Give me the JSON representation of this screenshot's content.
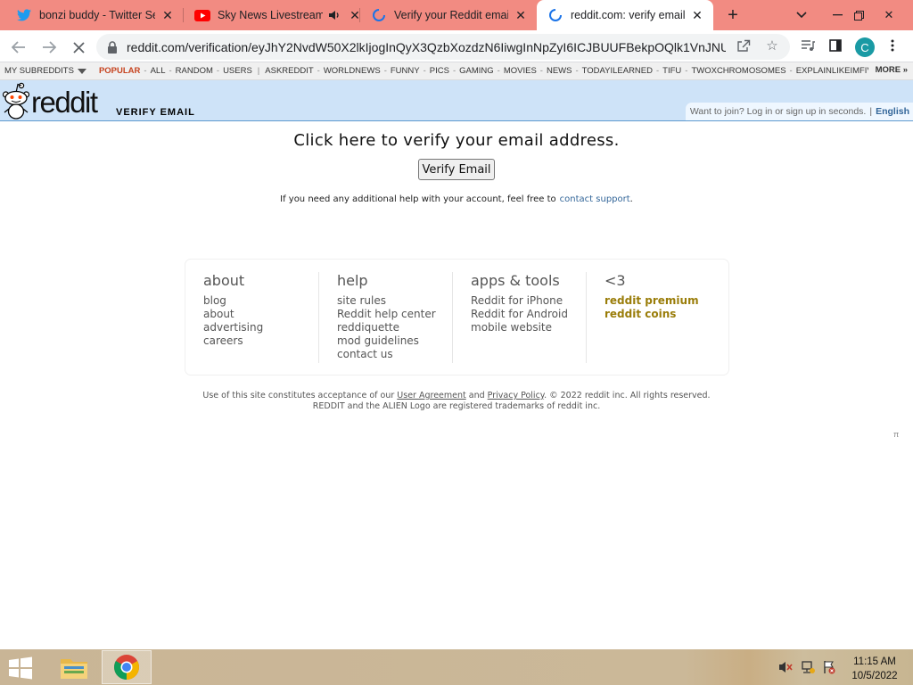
{
  "browser": {
    "tabs": [
      {
        "title": "bonzi buddy - Twitter Se",
        "favicon": "twitter-icon"
      },
      {
        "title": "Sky News Livestream",
        "favicon": "youtube-icon",
        "audio": true
      },
      {
        "title": "Verify your Reddit email",
        "favicon": "loading-spinner-icon"
      },
      {
        "title": "reddit.com: verify email",
        "favicon": "loading-spinner-icon",
        "active": true
      }
    ],
    "url": "reddit.com/verification/eyJhY2NvdW50X2lkIjogInQyX3QzbXozdzN6IiwgInNpZyI6ICJBUUFBekpOQlk1VnJNU...",
    "profile_initial": "C"
  },
  "subreddit_bar": {
    "my_subreddits": "MY SUBREDDITS",
    "popular": "POPULAR",
    "group1": [
      "ALL",
      "RANDOM",
      "USERS"
    ],
    "group2": [
      "ASKREDDIT",
      "WORLDNEWS",
      "FUNNY",
      "PICS",
      "GAMING",
      "MOVIES",
      "NEWS",
      "TODAYILEARNED",
      "TIFU",
      "TWOXCHROMOSOMES",
      "EXPLAINLIKEIMFIVE"
    ],
    "more": "MORE »"
  },
  "header": {
    "logo_text": "reddit",
    "page_name": "VERIFY EMAIL",
    "join_text": "Want to join? Log in or sign up in seconds.",
    "language": "English"
  },
  "main": {
    "heading": "Click here to verify your email address.",
    "button_label": "Verify Email",
    "help_text": "If you need any additional help with your account, feel free to",
    "help_link": "contact support",
    "help_end": "."
  },
  "footer": {
    "columns": [
      {
        "title": "about",
        "links": [
          "blog",
          "about",
          "advertising",
          "careers"
        ]
      },
      {
        "title": "help",
        "links": [
          "site rules",
          "Reddit help center",
          "reddiquette",
          "mod guidelines",
          "contact us"
        ]
      },
      {
        "title": "apps & tools",
        "links": [
          "Reddit for iPhone",
          "Reddit for Android",
          "mobile website"
        ]
      },
      {
        "title": "<3",
        "links": [
          "reddit premium",
          "reddit coins"
        ],
        "highlight": true
      }
    ],
    "legal_prefix": "Use of this site constitutes acceptance of our",
    "user_agreement": "User Agreement",
    "and": "and",
    "privacy_policy": "Privacy Policy",
    "legal_suffix": ". © 2022 reddit inc. All rights reserved.",
    "trademark": "REDDIT and the ALIEN Logo are registered trademarks of reddit inc.",
    "pi_symbol": "π"
  },
  "taskbar": {
    "time": "11:15 AM",
    "date": "10/5/2022"
  },
  "colors": {
    "tabstrip": "#f28b82",
    "reddit_header": "#cee3f8",
    "popular": "#c6431f",
    "gold_link": "#9a7d0a"
  }
}
